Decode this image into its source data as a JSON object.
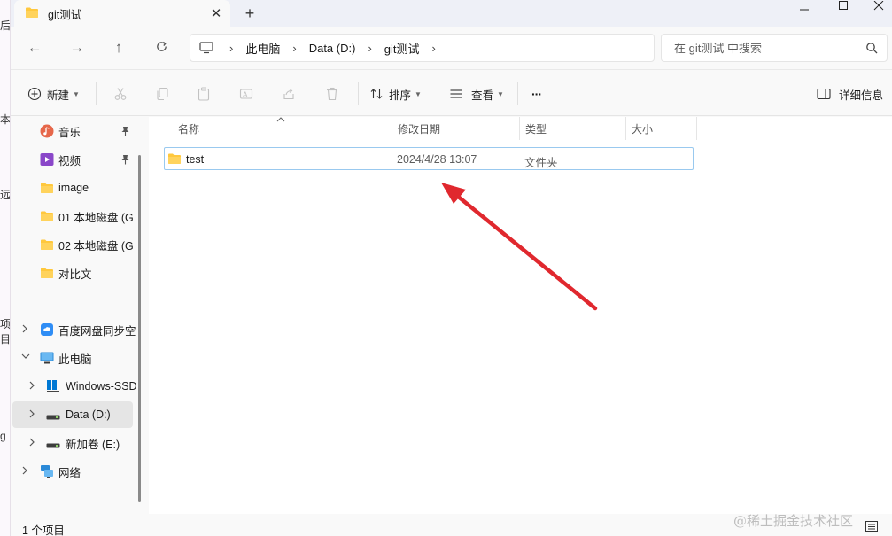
{
  "window": {
    "tab_title": "git测试",
    "tab_close": "✕",
    "new_tab": "+"
  },
  "navigation": {
    "back": "←",
    "forward": "→",
    "up": "↑"
  },
  "address": {
    "crumbs": [
      "此电脑",
      "Data (D:)",
      "git测试"
    ],
    "separator": "›"
  },
  "search": {
    "placeholder": "在 git测试 中搜索"
  },
  "toolbar": {
    "new_label": "新建",
    "sort_label": "排序",
    "view_label": "查看",
    "more_label": "···",
    "details_label": "详细信息"
  },
  "sidebar": {
    "items": [
      {
        "label": "音乐",
        "icon": "music-icon",
        "pinned": true
      },
      {
        "label": "视频",
        "icon": "video-icon",
        "pinned": true
      },
      {
        "label": "image",
        "icon": "folder-icon"
      },
      {
        "label": "01 本地磁盘 (G",
        "icon": "folder-icon"
      },
      {
        "label": "02 本地磁盘 (G",
        "icon": "folder-icon"
      },
      {
        "label": "对比文",
        "icon": "folder-icon"
      },
      {
        "label": "百度网盘同步空",
        "icon": "baidu-cloud-icon"
      },
      {
        "label": "此电脑",
        "icon": "computer-icon"
      },
      {
        "label": "Windows-SSD",
        "icon": "windows-drive-icon"
      },
      {
        "label": "Data (D:)",
        "icon": "drive-icon",
        "selected": true
      },
      {
        "label": "新加卷 (E:)",
        "icon": "drive-icon"
      },
      {
        "label": "网络",
        "icon": "network-icon"
      }
    ]
  },
  "columns": {
    "name": "名称",
    "modified": "修改日期",
    "type": "类型",
    "size": "大小"
  },
  "files": [
    {
      "name": "test",
      "modified": "2024/4/28 13:07",
      "type": "文件夹",
      "size": ""
    }
  ],
  "status": {
    "item_count": "1 个项目"
  },
  "watermark": "@稀土掘金技术社区",
  "background_window": {
    "fragments": [
      "后",
      "本",
      "远",
      "项目",
      "g"
    ]
  },
  "colors": {
    "accent": "#0067c0",
    "folder": "#ffc83d",
    "annotation_arrow": "#e0282e",
    "selection_border": "#99c9ef"
  }
}
